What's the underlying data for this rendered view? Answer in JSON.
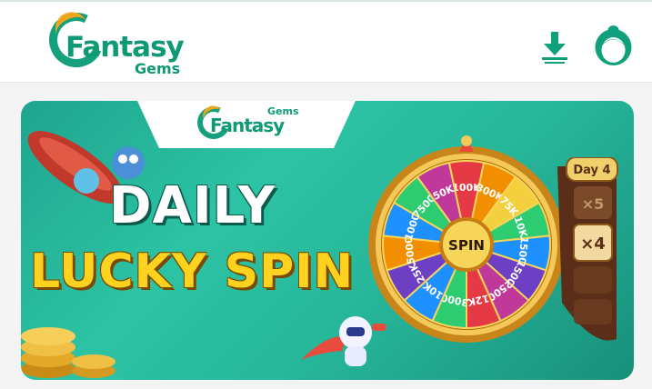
{
  "header": {
    "logo_word": "Fantasy",
    "logo_sub": "Gems",
    "download_icon": "download-icon",
    "avatar_icon": "support-agent-icon"
  },
  "banner": {
    "tab_logo_word": "Fantasy",
    "tab_logo_sub": "Gems",
    "headline_line1": "DAILY",
    "headline_line2": "LUCKY SPIN",
    "wheel_center": "SPIN",
    "wheel_segments": [
      "100K",
      "300K",
      "75K",
      "10K",
      "1500",
      "1500",
      "2500",
      "12K",
      "3000",
      "10K",
      "25K",
      "5000",
      "1000",
      "7500",
      "50K"
    ],
    "day_label": "Day 4",
    "multipliers": [
      "×5",
      "×4"
    ],
    "colors": {
      "accent_green": "#14a07c",
      "accent_orange": "#f3a51a",
      "headline_yellow": "#ffd21f"
    }
  }
}
